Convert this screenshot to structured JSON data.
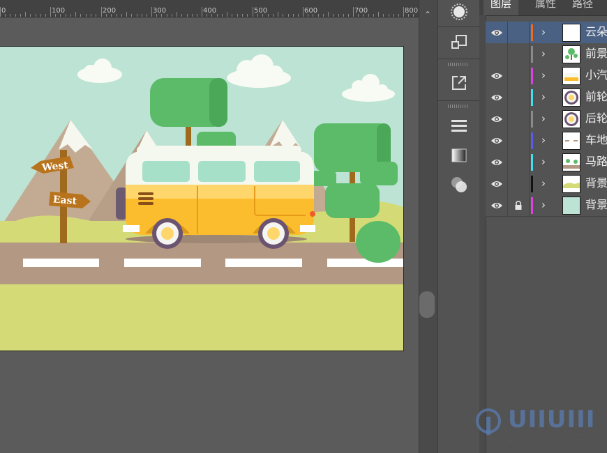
{
  "ruler": {
    "labels": [
      "0",
      "100",
      "200",
      "300",
      "400",
      "500",
      "600",
      "700",
      "800"
    ]
  },
  "artboard": {
    "signs": {
      "west": "West",
      "east": "East"
    }
  },
  "toolstrip": {
    "tools": [
      "brush-options-icon",
      "transform-icon",
      "export-icon",
      "align-icon",
      "gradient-icon",
      "pathfinder-icon"
    ]
  },
  "layers_panel": {
    "tabs": [
      {
        "label": "图层",
        "active": true
      },
      {
        "label": "属性",
        "active": false
      },
      {
        "label": "路径",
        "active": false
      }
    ],
    "layers": [
      {
        "name": "云朵",
        "visible": true,
        "locked": false,
        "color": "#f06a1a",
        "selected": true,
        "thumb": "white"
      },
      {
        "name": "前景",
        "visible": false,
        "locked": false,
        "color": "#8a8a8a",
        "selected": false,
        "thumb": "trees"
      },
      {
        "name": "小汽车",
        "visible": true,
        "locked": false,
        "color": "#e040e0",
        "selected": false,
        "thumb": "car"
      },
      {
        "name": "前轮",
        "visible": true,
        "locked": false,
        "color": "#40e0f0",
        "selected": false,
        "thumb": "wheel"
      },
      {
        "name": "后轮",
        "visible": true,
        "locked": false,
        "color": "#8a8a8a",
        "selected": false,
        "thumb": "wheel"
      },
      {
        "name": "车地",
        "visible": true,
        "locked": false,
        "color": "#5a5af0",
        "selected": false,
        "thumb": "shadow"
      },
      {
        "name": "马路",
        "visible": true,
        "locked": false,
        "color": "#40e0f0",
        "selected": false,
        "thumb": "road"
      },
      {
        "name": "背景",
        "visible": true,
        "locked": false,
        "color": "#111111",
        "selected": false,
        "thumb": "hills"
      },
      {
        "name": "背景",
        "visible": true,
        "locked": true,
        "color": "#e040e0",
        "selected": false,
        "thumb": "sky"
      }
    ]
  },
  "watermark": {
    "text": "UIIUIII"
  },
  "colors": {
    "sky": "#bce3d4",
    "grass": "#d4da76",
    "road": "#b39883",
    "selected_row": "#4b6183"
  }
}
